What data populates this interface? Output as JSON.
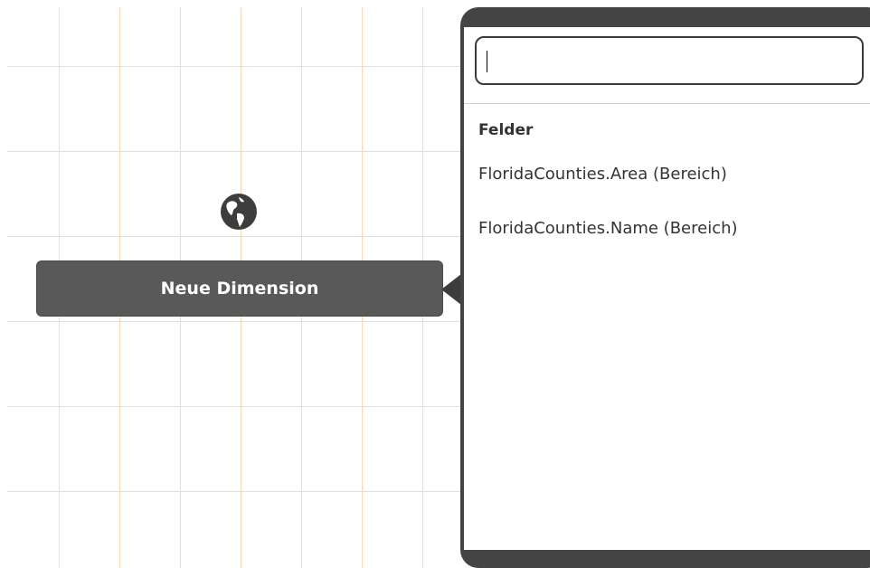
{
  "dimension_button": {
    "label": "Neue Dimension"
  },
  "icons": {
    "globe": "globe-icon",
    "popover_arrow": "triangle-left-icon"
  },
  "field_picker": {
    "search": {
      "value": "",
      "placeholder": ""
    },
    "section_title": "Felder",
    "fields": [
      {
        "label": "FloridaCounties.Area (Bereich)"
      },
      {
        "label": "FloridaCounties.Name (Bereich)"
      }
    ]
  },
  "colors": {
    "grid_line": "#fbd9bd",
    "button_bg": "#595959",
    "popover_frame": "#444444",
    "text": "#333333"
  }
}
